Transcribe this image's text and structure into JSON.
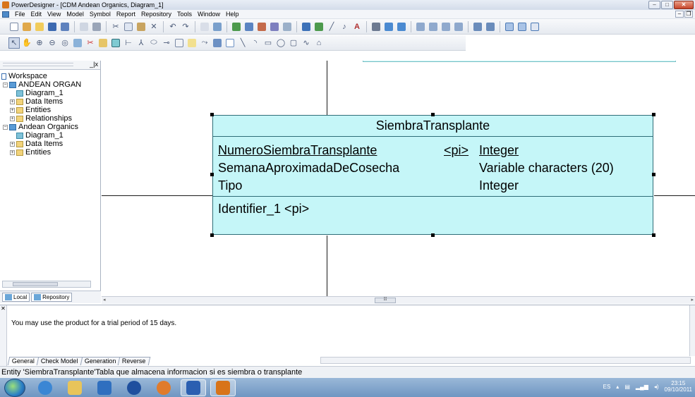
{
  "window": {
    "title": "PowerDesigner - [CDM Andean Organics, Diagram_1]",
    "buttons": {
      "minimize": "–",
      "maximize": "□",
      "close": "✕"
    }
  },
  "menu": {
    "items": [
      "File",
      "Edit",
      "View",
      "Model",
      "Symbol",
      "Report",
      "Repository",
      "Tools",
      "Window",
      "Help"
    ],
    "mdi": {
      "minimize": "–",
      "restore": "❐"
    }
  },
  "browser": {
    "tree": [
      {
        "label": "Workspace"
      },
      {
        "label": "ANDEAN ORGAN"
      },
      {
        "label": "Diagram_1"
      },
      {
        "label": "Data Items"
      },
      {
        "label": "Entities"
      },
      {
        "label": "Relationships"
      },
      {
        "label": "Andean Organics"
      },
      {
        "label": "Diagram_1"
      },
      {
        "label": "Data Items"
      },
      {
        "label": "Entities"
      }
    ],
    "tabs": [
      "Local",
      "Repository"
    ],
    "close_glyph": "_|x"
  },
  "entity": {
    "name": "SiembraTransplante",
    "attributes": [
      {
        "name": "NumeroSiembraTransplante",
        "key": "<pi>",
        "type": "Integer",
        "primary": true
      },
      {
        "name": "SemanaAproximadaDeCosecha",
        "key": "",
        "type": "Variable characters (20)",
        "primary": false
      },
      {
        "name": "Tipo",
        "key": "",
        "type": "Integer",
        "primary": false
      }
    ],
    "identifier": "Identifier_1  <pi>"
  },
  "output": {
    "message": "You may use the product for a trial period of 15 days.",
    "tabs": [
      "General",
      "Check Model",
      "Generation",
      "Reverse"
    ]
  },
  "status": {
    "text": "Entity 'SiembraTransplante'Tabla que almacena informacion  si es siembra o transplante"
  },
  "taskbar": {
    "lang": "ES",
    "time": "23:15",
    "date": "09/10/2011"
  },
  "colors": {
    "entity_fill": "#c5f6f8",
    "entity_border": "#2f6e78"
  }
}
